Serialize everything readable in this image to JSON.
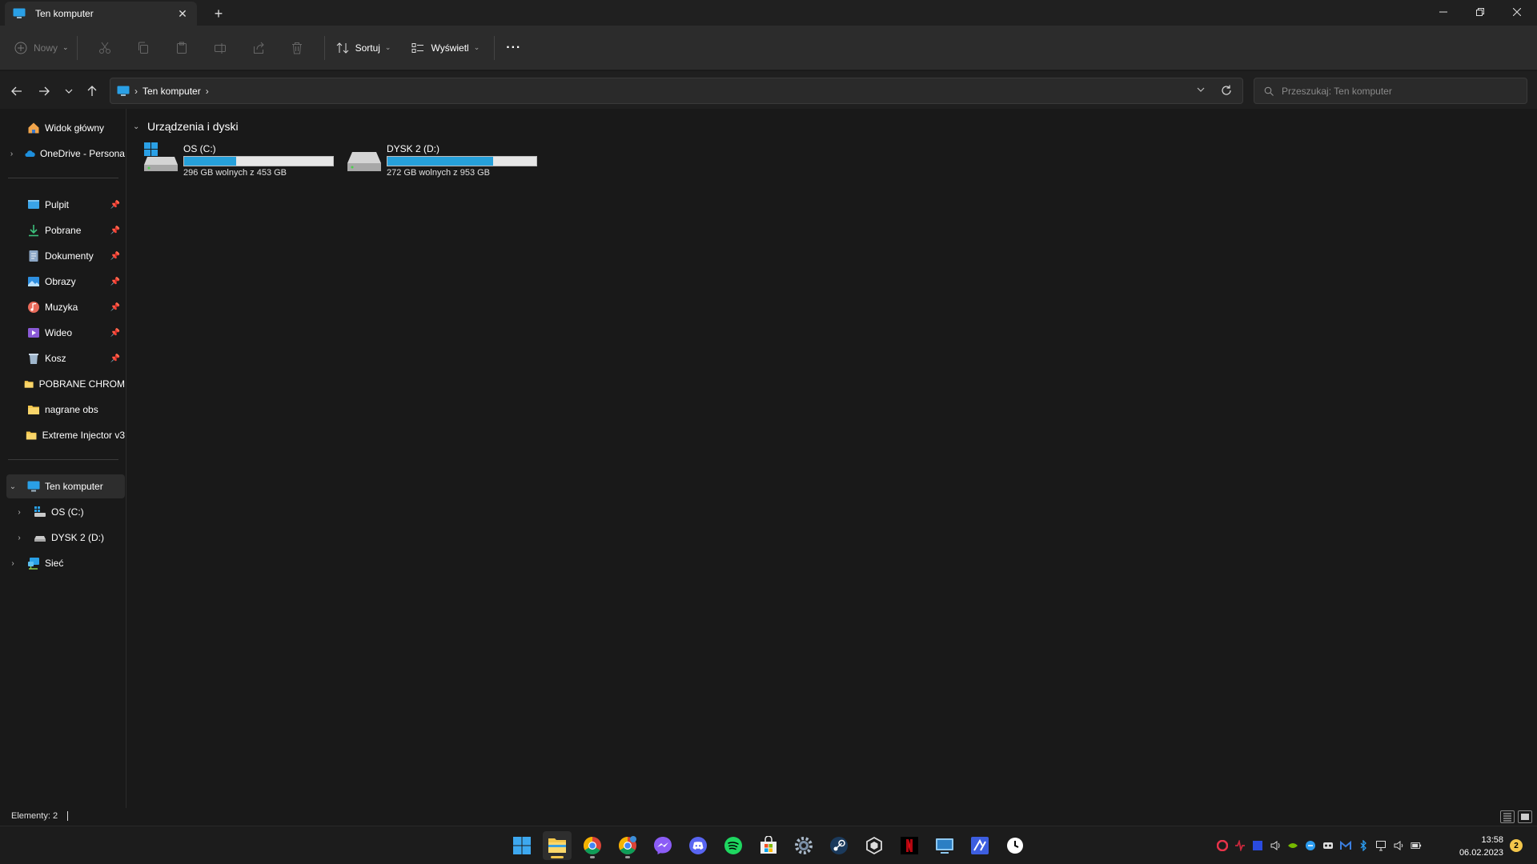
{
  "window": {
    "tab_title": "Ten komputer",
    "new_tab_glyph": "+",
    "tab_close_glyph": "✕"
  },
  "toolbar": {
    "new_label": "Nowy",
    "sort_label": "Sortuj",
    "view_label": "Wyświetl",
    "more_label": "···"
  },
  "address": {
    "crumbs": [
      "Ten komputer"
    ],
    "search_placeholder": "Przeszukaj: Ten komputer"
  },
  "sidebar": {
    "top_items": [
      {
        "label": "Widok główny",
        "icon": "home-icon"
      },
      {
        "label": "OneDrive - Persona",
        "icon": "onedrive-cloud-icon"
      }
    ],
    "quick_access": [
      {
        "label": "Pulpit",
        "icon": "desktop-icon",
        "pinned": true
      },
      {
        "label": "Pobrane",
        "icon": "download-icon",
        "pinned": true
      },
      {
        "label": "Dokumenty",
        "icon": "documents-icon",
        "pinned": true
      },
      {
        "label": "Obrazy",
        "icon": "pictures-icon",
        "pinned": true
      },
      {
        "label": "Muzyka",
        "icon": "music-icon",
        "pinned": true
      },
      {
        "label": "Wideo",
        "icon": "video-icon",
        "pinned": true
      },
      {
        "label": "Kosz",
        "icon": "recycle-bin-icon",
        "pinned": true
      },
      {
        "label": "POBRANE CHROM",
        "icon": "folder-icon",
        "pinned": false
      },
      {
        "label": "nagrane obs",
        "icon": "folder-icon",
        "pinned": false
      },
      {
        "label": "Extreme Injector v3",
        "icon": "folder-icon",
        "pinned": false
      }
    ],
    "tree": [
      {
        "label": "Ten komputer",
        "icon": "computer-icon",
        "expanded": true,
        "selected": true
      },
      {
        "label": "OS (C:)",
        "icon": "os-drive-icon"
      },
      {
        "label": "DYSK 2 (D:)",
        "icon": "drive-icon"
      },
      {
        "label": "Sieć",
        "icon": "network-icon"
      }
    ],
    "pin_glyph": "📌"
  },
  "content": {
    "group_title": "Urządzenia i dyski",
    "drives": [
      {
        "name": "OS (C:)",
        "free_text": "296 GB wolnych z 453 GB",
        "used_fraction": 0.35
      },
      {
        "name": "DYSK 2 (D:)",
        "free_text": "272 GB wolnych z 953 GB",
        "used_fraction": 0.71
      }
    ]
  },
  "status": {
    "items_text": "Elementy: 2"
  },
  "taskbar": {
    "apps": [
      "start-icon",
      "file-explorer-icon",
      "chrome-icon",
      "chrome-profile-icon",
      "messenger-icon",
      "discord-icon",
      "spotify-icon",
      "microsoft-store-icon",
      "settings-icon",
      "steam-icon",
      "unity-hub-icon",
      "netflix-icon",
      "remote-desktop-icon",
      "app-icon",
      "clock-app-icon"
    ],
    "time": "13:58",
    "date": "06.02.2023",
    "notification_count": "2"
  },
  "colors": {
    "accent": "#26a0da",
    "folder": "#f3c64b",
    "background": "#191919"
  }
}
